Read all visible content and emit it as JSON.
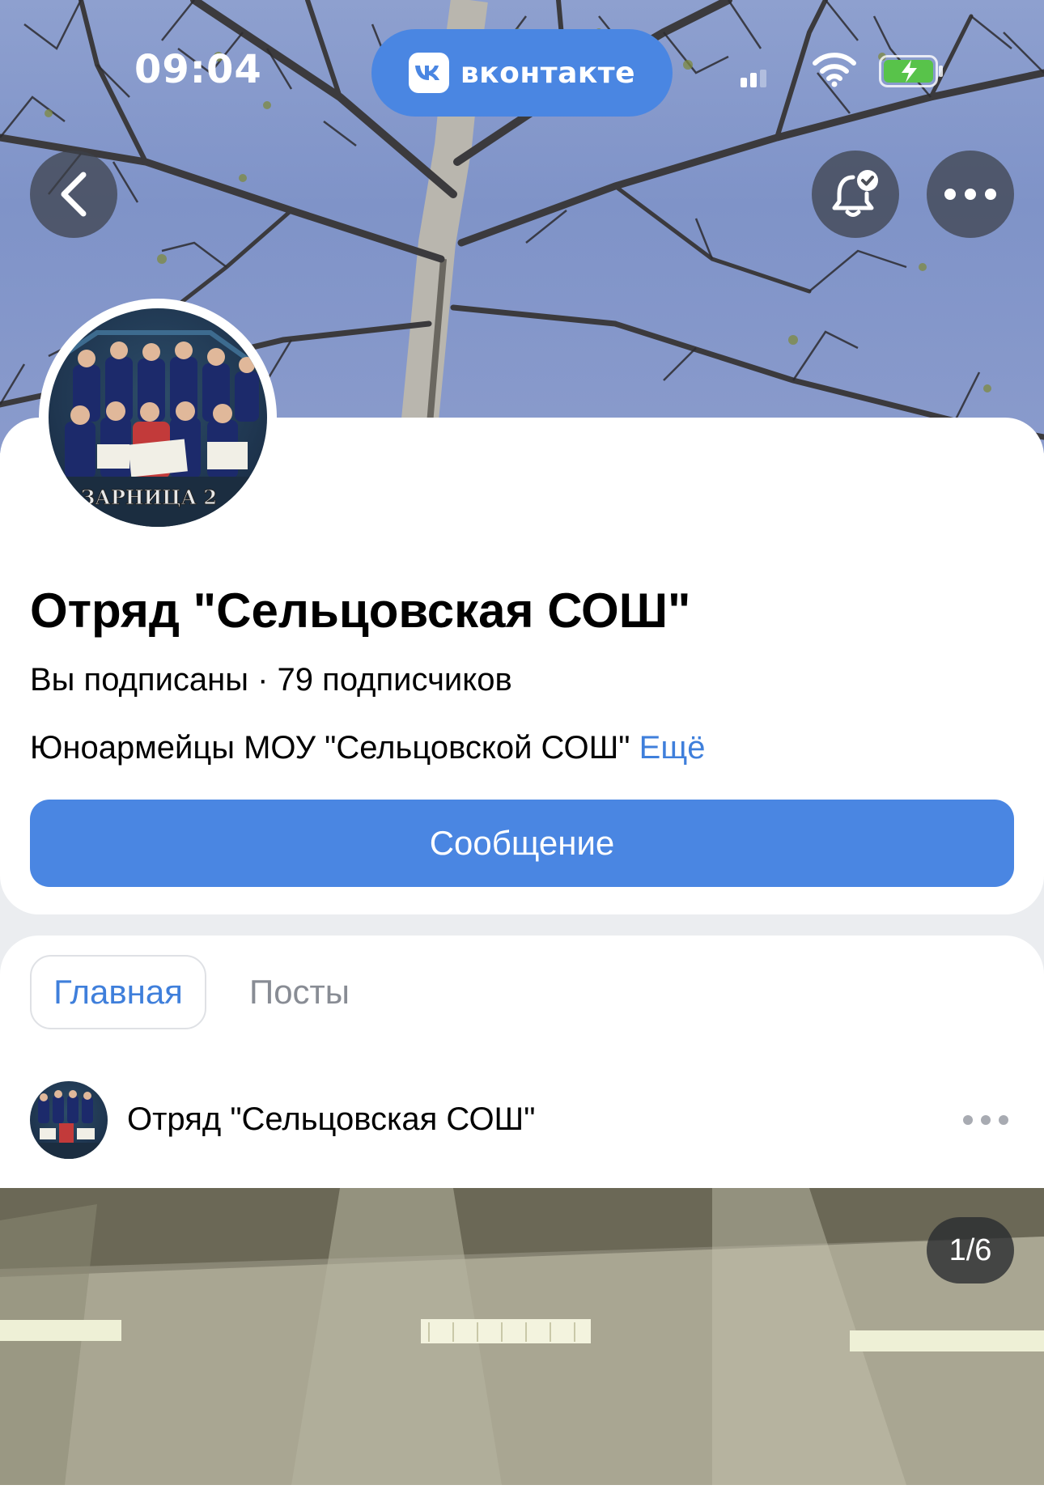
{
  "status_bar": {
    "time": "09:04",
    "app_pill": "вконтакте",
    "icons": [
      "signal-icon",
      "wifi-icon",
      "battery-charging-icon"
    ]
  },
  "nav": {
    "back_icon": "back-chevron-icon",
    "notify_icon": "bell-check-icon",
    "more_icon": "more-dots-icon"
  },
  "group": {
    "title": "Отряд \"Сельцовская СОШ\"",
    "subscription": "Вы подписаны · 79 подписчиков",
    "description": "Юноармейцы МОУ \"Сельцовской СОШ\"",
    "more_link": "Ещё",
    "message_button": "Сообщение",
    "avatar_caption": "ЗАРНИЦА 2"
  },
  "tabs": [
    {
      "label": "Главная",
      "active": true
    },
    {
      "label": "Посты",
      "active": false
    }
  ],
  "post": {
    "author": "Отряд \"Сельцовская СОШ\"",
    "photo_counter": "1/6",
    "more_icon": "more-dots-icon"
  },
  "colors": {
    "accent": "#4a86e2",
    "link": "#3f7fdb",
    "background": "#ebedf0"
  }
}
